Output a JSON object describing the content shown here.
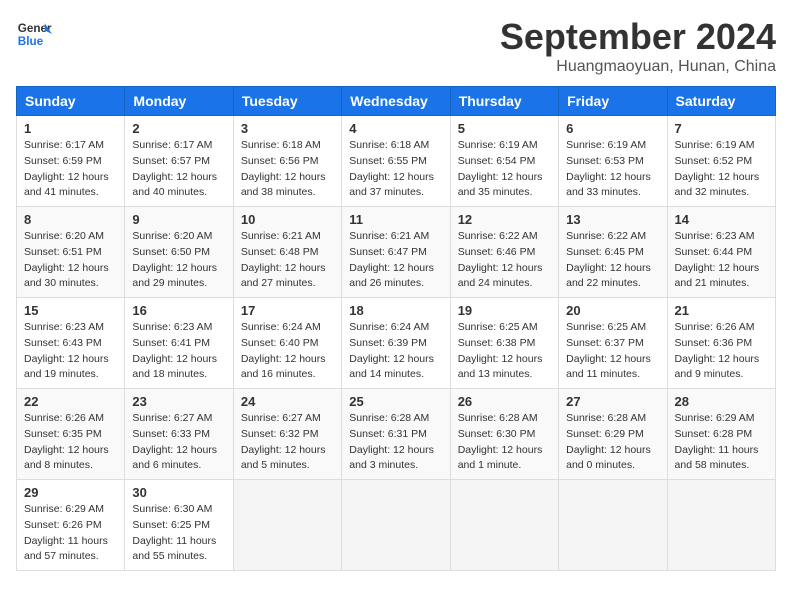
{
  "header": {
    "logo_line1": "General",
    "logo_line2": "Blue",
    "month": "September 2024",
    "location": "Huangmaoyuan, Hunan, China"
  },
  "weekdays": [
    "Sunday",
    "Monday",
    "Tuesday",
    "Wednesday",
    "Thursday",
    "Friday",
    "Saturday"
  ],
  "weeks": [
    [
      {
        "day": "1",
        "sunrise": "6:17 AM",
        "sunset": "6:59 PM",
        "daylight": "12 hours and 41 minutes."
      },
      {
        "day": "2",
        "sunrise": "6:17 AM",
        "sunset": "6:57 PM",
        "daylight": "12 hours and 40 minutes."
      },
      {
        "day": "3",
        "sunrise": "6:18 AM",
        "sunset": "6:56 PM",
        "daylight": "12 hours and 38 minutes."
      },
      {
        "day": "4",
        "sunrise": "6:18 AM",
        "sunset": "6:55 PM",
        "daylight": "12 hours and 37 minutes."
      },
      {
        "day": "5",
        "sunrise": "6:19 AM",
        "sunset": "6:54 PM",
        "daylight": "12 hours and 35 minutes."
      },
      {
        "day": "6",
        "sunrise": "6:19 AM",
        "sunset": "6:53 PM",
        "daylight": "12 hours and 33 minutes."
      },
      {
        "day": "7",
        "sunrise": "6:19 AM",
        "sunset": "6:52 PM",
        "daylight": "12 hours and 32 minutes."
      }
    ],
    [
      {
        "day": "8",
        "sunrise": "6:20 AM",
        "sunset": "6:51 PM",
        "daylight": "12 hours and 30 minutes."
      },
      {
        "day": "9",
        "sunrise": "6:20 AM",
        "sunset": "6:50 PM",
        "daylight": "12 hours and 29 minutes."
      },
      {
        "day": "10",
        "sunrise": "6:21 AM",
        "sunset": "6:48 PM",
        "daylight": "12 hours and 27 minutes."
      },
      {
        "day": "11",
        "sunrise": "6:21 AM",
        "sunset": "6:47 PM",
        "daylight": "12 hours and 26 minutes."
      },
      {
        "day": "12",
        "sunrise": "6:22 AM",
        "sunset": "6:46 PM",
        "daylight": "12 hours and 24 minutes."
      },
      {
        "day": "13",
        "sunrise": "6:22 AM",
        "sunset": "6:45 PM",
        "daylight": "12 hours and 22 minutes."
      },
      {
        "day": "14",
        "sunrise": "6:23 AM",
        "sunset": "6:44 PM",
        "daylight": "12 hours and 21 minutes."
      }
    ],
    [
      {
        "day": "15",
        "sunrise": "6:23 AM",
        "sunset": "6:43 PM",
        "daylight": "12 hours and 19 minutes."
      },
      {
        "day": "16",
        "sunrise": "6:23 AM",
        "sunset": "6:41 PM",
        "daylight": "12 hours and 18 minutes."
      },
      {
        "day": "17",
        "sunrise": "6:24 AM",
        "sunset": "6:40 PM",
        "daylight": "12 hours and 16 minutes."
      },
      {
        "day": "18",
        "sunrise": "6:24 AM",
        "sunset": "6:39 PM",
        "daylight": "12 hours and 14 minutes."
      },
      {
        "day": "19",
        "sunrise": "6:25 AM",
        "sunset": "6:38 PM",
        "daylight": "12 hours and 13 minutes."
      },
      {
        "day": "20",
        "sunrise": "6:25 AM",
        "sunset": "6:37 PM",
        "daylight": "12 hours and 11 minutes."
      },
      {
        "day": "21",
        "sunrise": "6:26 AM",
        "sunset": "6:36 PM",
        "daylight": "12 hours and 9 minutes."
      }
    ],
    [
      {
        "day": "22",
        "sunrise": "6:26 AM",
        "sunset": "6:35 PM",
        "daylight": "12 hours and 8 minutes."
      },
      {
        "day": "23",
        "sunrise": "6:27 AM",
        "sunset": "6:33 PM",
        "daylight": "12 hours and 6 minutes."
      },
      {
        "day": "24",
        "sunrise": "6:27 AM",
        "sunset": "6:32 PM",
        "daylight": "12 hours and 5 minutes."
      },
      {
        "day": "25",
        "sunrise": "6:28 AM",
        "sunset": "6:31 PM",
        "daylight": "12 hours and 3 minutes."
      },
      {
        "day": "26",
        "sunrise": "6:28 AM",
        "sunset": "6:30 PM",
        "daylight": "12 hours and 1 minute."
      },
      {
        "day": "27",
        "sunrise": "6:28 AM",
        "sunset": "6:29 PM",
        "daylight": "12 hours and 0 minutes."
      },
      {
        "day": "28",
        "sunrise": "6:29 AM",
        "sunset": "6:28 PM",
        "daylight": "11 hours and 58 minutes."
      }
    ],
    [
      {
        "day": "29",
        "sunrise": "6:29 AM",
        "sunset": "6:26 PM",
        "daylight": "11 hours and 57 minutes."
      },
      {
        "day": "30",
        "sunrise": "6:30 AM",
        "sunset": "6:25 PM",
        "daylight": "11 hours and 55 minutes."
      },
      {
        "day": "",
        "sunrise": "",
        "sunset": "",
        "daylight": ""
      },
      {
        "day": "",
        "sunrise": "",
        "sunset": "",
        "daylight": ""
      },
      {
        "day": "",
        "sunrise": "",
        "sunset": "",
        "daylight": ""
      },
      {
        "day": "",
        "sunrise": "",
        "sunset": "",
        "daylight": ""
      },
      {
        "day": "",
        "sunrise": "",
        "sunset": "",
        "daylight": ""
      }
    ]
  ]
}
